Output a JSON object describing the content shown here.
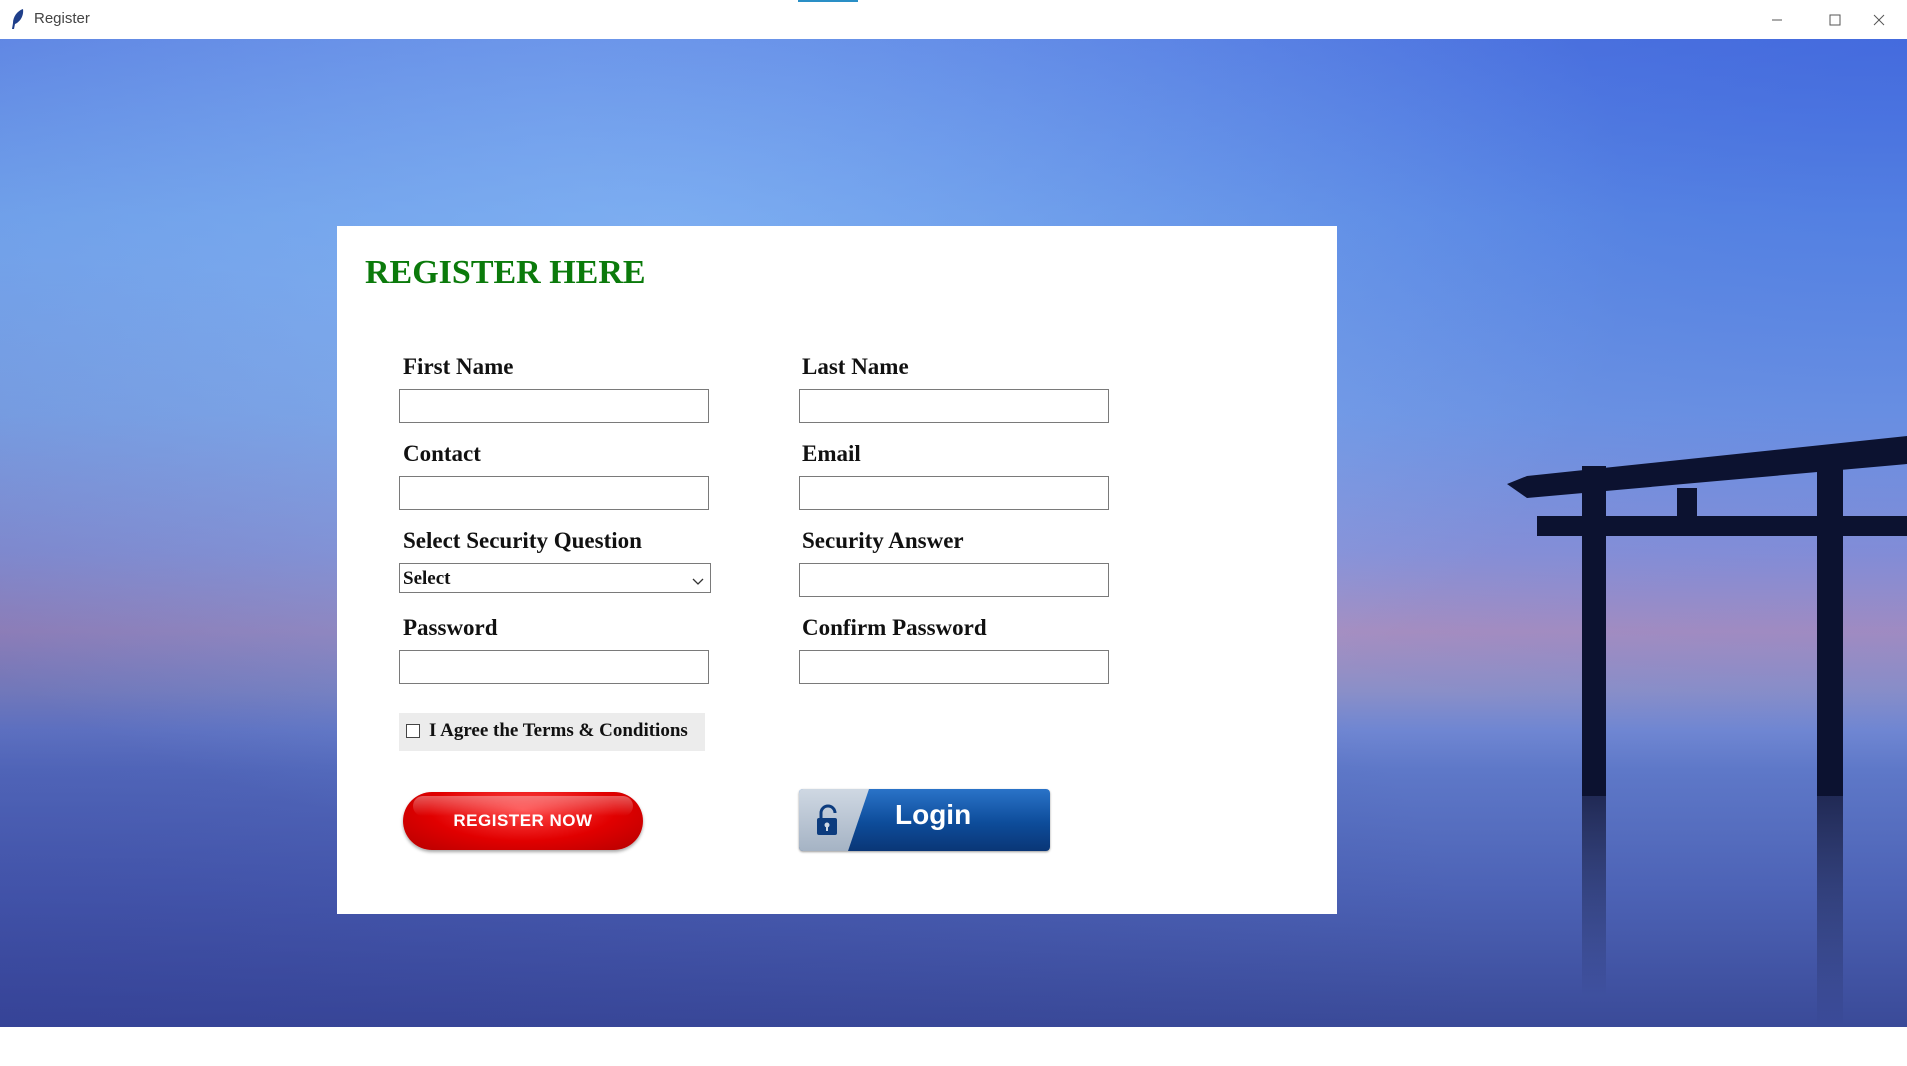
{
  "window": {
    "title": "Register",
    "controls": [
      "minimize-icon",
      "maximize-icon",
      "close-icon"
    ]
  },
  "form": {
    "heading": "REGISTER HERE",
    "fields": {
      "first_name": {
        "label": "First Name",
        "value": ""
      },
      "last_name": {
        "label": "Last Name",
        "value": ""
      },
      "contact": {
        "label": "Contact",
        "value": ""
      },
      "email": {
        "label": "Email",
        "value": ""
      },
      "security_question": {
        "label": "Select Security Question",
        "selected": "Select"
      },
      "security_answer": {
        "label": "Security Answer",
        "value": ""
      },
      "password": {
        "label": "Password",
        "value": ""
      },
      "confirm_password": {
        "label": "Confirm Password",
        "value": ""
      }
    },
    "agree": {
      "label": "I Agree the Terms & Conditions",
      "checked": false
    },
    "register_button": "REGISTER NOW",
    "login_button": "Login"
  },
  "colors": {
    "heading": "#0b7a0b",
    "register_button": "#e10000",
    "login_button": "#0d4c9a"
  }
}
